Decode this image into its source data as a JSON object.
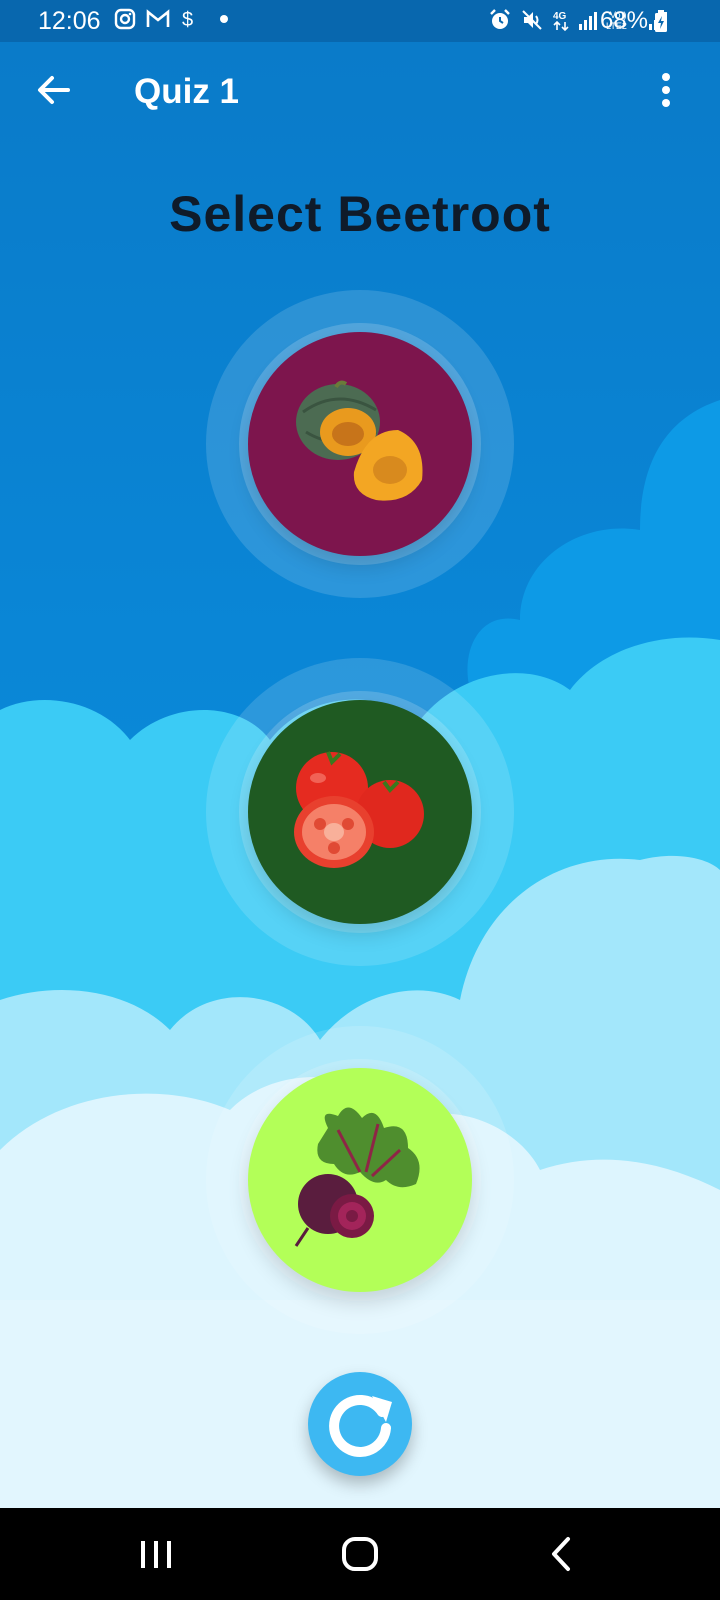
{
  "status_bar": {
    "time": "12:06",
    "battery": "68%",
    "left_icons": [
      "instagram-icon",
      "gmail-icon",
      "dollar-icon",
      "dot-icon"
    ],
    "right_icons": [
      "alarm-icon",
      "mute-icon",
      "4g-icon",
      "signal-icon",
      "volte-icon",
      "signal-icon",
      "battery-charging-icon"
    ]
  },
  "app_bar": {
    "title": "Quiz 1"
  },
  "prompt": "Select Beetroot",
  "options": [
    {
      "name": "pumpkin",
      "bg_color": "#7D154D"
    },
    {
      "name": "tomato",
      "bg_color": "#1F5A22"
    },
    {
      "name": "beetroot",
      "bg_color": "#B3FF58"
    }
  ],
  "colors": {
    "sky": "#0A86D6",
    "reload_button": "#3DB8F2"
  }
}
